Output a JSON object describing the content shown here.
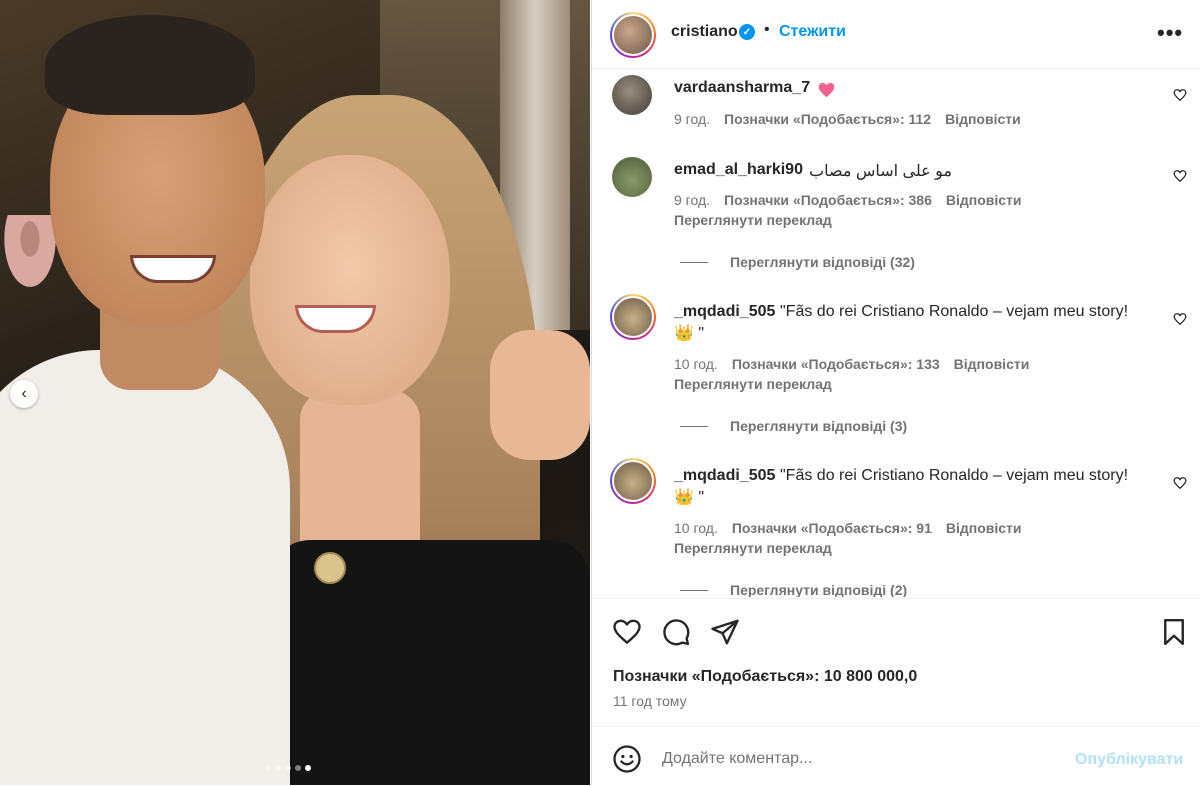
{
  "header": {
    "username": "cristiano",
    "verified": true,
    "separator": "•",
    "follow_label": "Стежити",
    "more_label": "•••"
  },
  "comments": [
    {
      "username": "vardaansharma_7",
      "text": "",
      "emoji": "pink-heart",
      "time": "9 год.",
      "likes": "Позначки «Подобається»: 112",
      "reply_label": "Відповісти"
    },
    {
      "username": "emad_al_harki90",
      "text": "مو على اساس مصاب",
      "time": "9 год.",
      "likes": "Позначки «Подобається»: 386",
      "reply_label": "Відповісти",
      "translate_label": "Переглянути переклад",
      "view_replies": "Переглянути відповіді (32)"
    },
    {
      "username": "_mqdadi_505",
      "text": "\"Fãs do rei Cristiano Ronaldo – vejam meu story!",
      "text_line2": "👑 \"",
      "time": "10 год.",
      "likes": "Позначки «Подобається»: 133",
      "reply_label": "Відповісти",
      "translate_label": "Переглянути переклад",
      "view_replies": "Переглянути відповіді (3)"
    },
    {
      "username": "_mqdadi_505",
      "text": "\"Fãs do rei Cristiano Ronaldo – vejam meu story!",
      "text_line2": "👑 \"",
      "time": "10 год.",
      "likes": "Позначки «Подобається»: 91",
      "reply_label": "Відповісти",
      "translate_label": "Переглянути переклад",
      "view_replies": "Переглянути відповіді (2)"
    }
  ],
  "post": {
    "likes": "Позначки «Подобається»: 10 800 000,0",
    "time_ago": "11 год тому"
  },
  "composer": {
    "placeholder": "Додайте коментар...",
    "publish_label": "Опублікувати"
  },
  "carousel": {
    "prev_label": "‹",
    "slide_count": 5,
    "active_slide": 5
  },
  "colors": {
    "accent": "#0095f6",
    "publish_disabled": "#b2dffc",
    "like_heart": "#ed4956",
    "secondary_text": "#737373"
  }
}
